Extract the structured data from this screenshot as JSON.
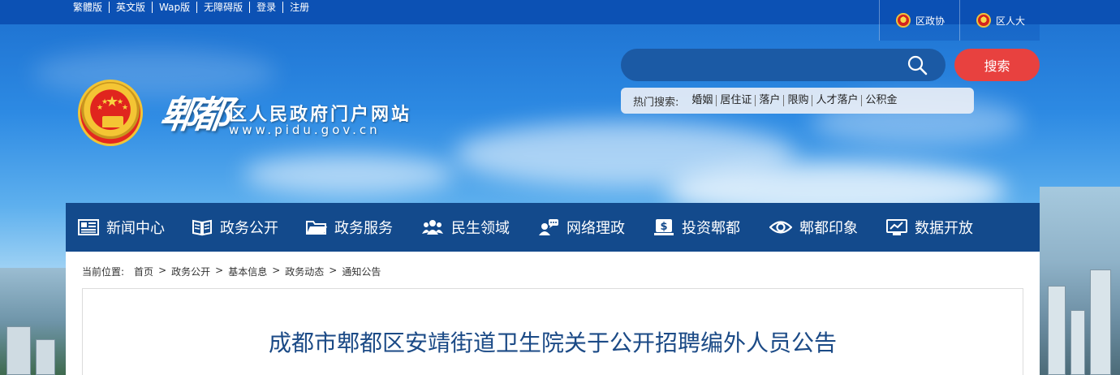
{
  "topbar": {
    "links": [
      "繁體版",
      "英文版",
      "Wap版",
      "无障碍版",
      "登录",
      "注册"
    ],
    "right_links": [
      "区政协",
      "区人大"
    ]
  },
  "logo": {
    "big": "郫都",
    "subtitle": "区人民政府门户网站",
    "url": "www.pidu.gov.cn"
  },
  "search": {
    "placeholder": "",
    "button_label": "搜索",
    "hot_label": "热门搜索:",
    "hot_terms": [
      "婚姻",
      "居住证",
      "落户",
      "限购",
      "人才落户",
      "公积金"
    ]
  },
  "nav": {
    "items": [
      {
        "label": "新闻中心",
        "icon": "newspaper-icon"
      },
      {
        "label": "政务公开",
        "icon": "book-icon"
      },
      {
        "label": "政务服务",
        "icon": "folder-icon"
      },
      {
        "label": "民生领域",
        "icon": "people-icon"
      },
      {
        "label": "网络理政",
        "icon": "chat-user-icon"
      },
      {
        "label": "投资郫都",
        "icon": "dollar-icon"
      },
      {
        "label": "郫都印象",
        "icon": "eye-icon"
      },
      {
        "label": "数据开放",
        "icon": "monitor-chart-icon"
      }
    ]
  },
  "breadcrumb": {
    "label": "当前位置:",
    "items": [
      "首页",
      "政务公开",
      "基本信息",
      "政务动态",
      "通知公告"
    ]
  },
  "article": {
    "title": "成都市郫都区安靖街道卫生院关于公开招聘编外人员公告"
  },
  "colors": {
    "topbar": "#0c51b4",
    "nav": "#134a8c",
    "search_button": "#e8413f",
    "title": "#1b4a86"
  }
}
